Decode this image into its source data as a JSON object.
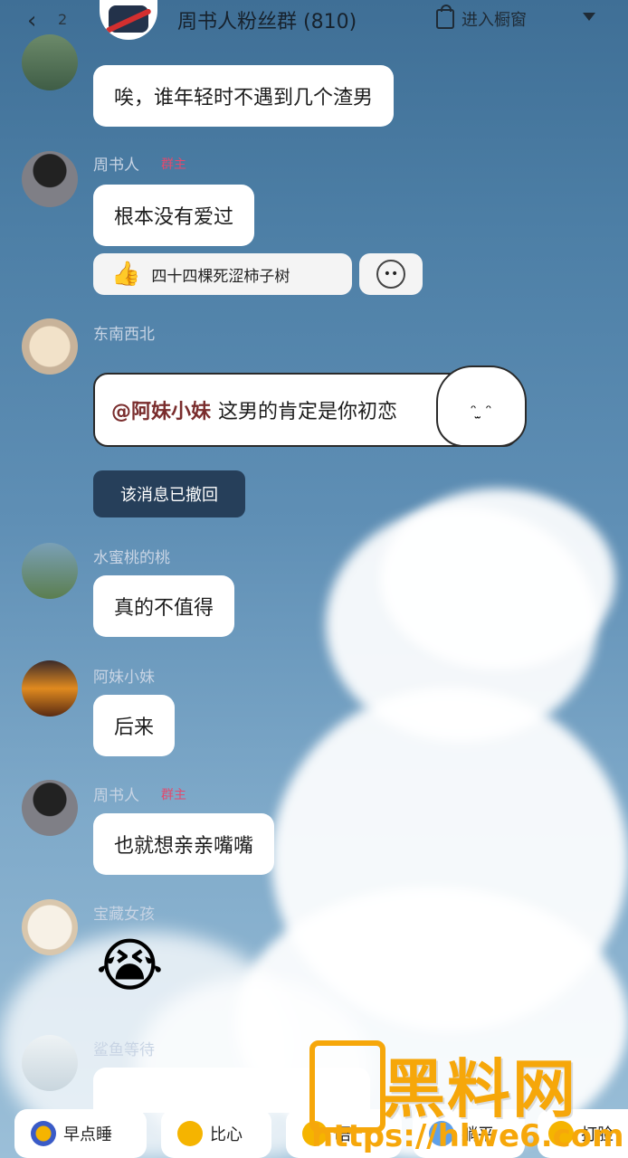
{
  "header": {
    "unread_count": "2",
    "title": "周书人粉丝群 (810)",
    "shop_label": "进入橱窗"
  },
  "messages": [
    {
      "text": "唉，谁年轻时不遇到几个渣男"
    },
    {
      "name": "周书人",
      "badge": "群主",
      "text": "根本没有爱过",
      "reaction_user": "四十四棵死涩柿子树"
    },
    {
      "name": "东南西北",
      "mention": "@阿妹小妹",
      "text": "这男的肯定是你初恋"
    },
    {
      "recalled": "该消息已撤回"
    },
    {
      "name": "水蜜桃的桃",
      "text": "真的不值得"
    },
    {
      "name": "阿妹小妹",
      "text": "后来"
    },
    {
      "name": "周书人",
      "badge": "群主",
      "text": "也就想亲亲嘴嘴"
    },
    {
      "name": "宝藏女孩",
      "emoji": "😭"
    },
    {
      "name": "鲨鱼等待"
    }
  ],
  "quick_actions": [
    "早点睡",
    "比心",
    "晤",
    "躺平",
    "打脸"
  ],
  "watermark": {
    "text": "黑料网",
    "url": "https://hlwe6.com"
  },
  "colors": {
    "accent_badge": "#e24a6e",
    "watermark": "#f6a70a"
  }
}
